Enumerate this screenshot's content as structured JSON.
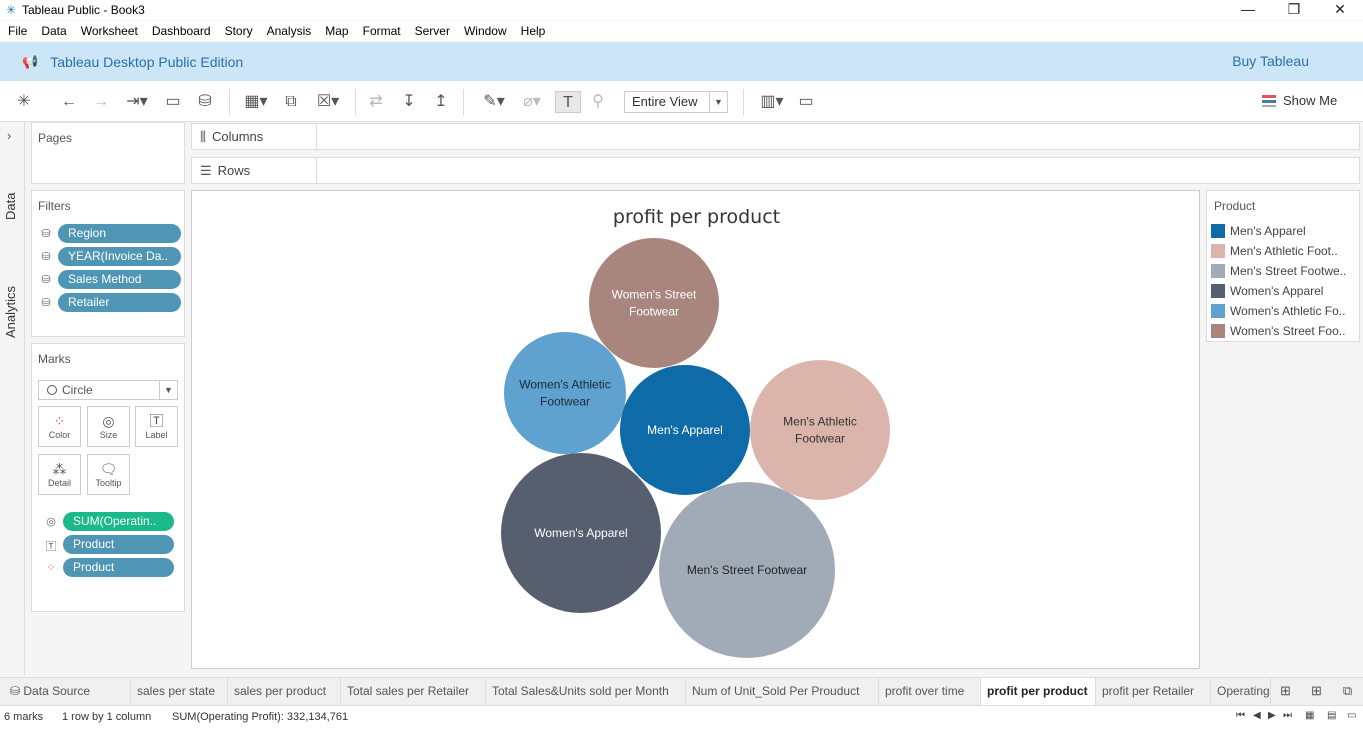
{
  "window": {
    "title": "Tableau Public - Book3",
    "minimize": "—",
    "maximize": "❐",
    "close": "✕"
  },
  "menu": [
    "File",
    "Data",
    "Worksheet",
    "Dashboard",
    "Story",
    "Analysis",
    "Map",
    "Format",
    "Server",
    "Window",
    "Help"
  ],
  "banner": {
    "edition": "Tableau Desktop Public Edition",
    "buy": "Buy Tableau"
  },
  "toolbar": {
    "fit": "Entire View",
    "show_me": "Show Me"
  },
  "side_tabs": {
    "data": "Data",
    "analytics": "Analytics"
  },
  "pages": {
    "title": "Pages"
  },
  "filters": {
    "title": "Filters",
    "items": [
      "Region",
      "YEAR(Invoice Da..",
      "Sales Method",
      "Retailer"
    ]
  },
  "marks": {
    "title": "Marks",
    "type": "Circle",
    "buttons": [
      "Color",
      "Size",
      "Label",
      "Detail",
      "Tooltip"
    ],
    "fields": [
      "SUM(Operatin..",
      "Product",
      "Product"
    ]
  },
  "shelves": {
    "columns": "Columns",
    "rows": "Rows"
  },
  "chart_data": {
    "type": "packed-bubble",
    "title": "profit per product",
    "measure": "SUM(Operating Profit)",
    "bubbles": [
      {
        "label_lines": [
          "Women's Street",
          "Footwear"
        ],
        "color": "#a8857d",
        "label_color": "#ffffff"
      },
      {
        "label_lines": [
          "Women's Athletic",
          "Footwear"
        ],
        "color": "#5fa1cf",
        "label_color": "#1b2b3a"
      },
      {
        "label_lines": [
          "Men's Apparel"
        ],
        "color": "#0f6ba8",
        "label_color": "#ffffff"
      },
      {
        "label_lines": [
          "Men's Athletic",
          "Footwear"
        ],
        "color": "#dbb5ab",
        "label_color": "#333333"
      },
      {
        "label_lines": [
          "Women's Apparel"
        ],
        "color": "#575e6d",
        "label_color": "#ffffff"
      },
      {
        "label_lines": [
          "Men's Street Footwear"
        ],
        "color": "#a1abb7",
        "label_color": "#222222"
      }
    ]
  },
  "legend": {
    "title": "Product",
    "items": [
      {
        "label": "Men's Apparel",
        "color": "#0f6ba8"
      },
      {
        "label": "Men's Athletic Foot..",
        "color": "#dbb5ab"
      },
      {
        "label": "Men's Street Footwe..",
        "color": "#a1abb7"
      },
      {
        "label": "Women's Apparel",
        "color": "#575e6d"
      },
      {
        "label": "Women's Athletic Fo..",
        "color": "#5fa1cf"
      },
      {
        "label": "Women's Street Foo..",
        "color": "#a8857d"
      }
    ]
  },
  "sheet_tabs": {
    "data_source": "Data Source",
    "sheets": [
      "sales per state",
      "sales per product",
      "Total sales per Retailer",
      "Total Sales&Units sold per Month",
      "Num of Unit_Sold Per Prouduct",
      "profit over time",
      "profit per product",
      "profit per Retailer",
      "Operating"
    ],
    "active": "profit per product"
  },
  "status": {
    "marks": "6 marks",
    "dims": "1 row by 1 column",
    "sum": "SUM(Operating Profit): 332,134,761"
  }
}
